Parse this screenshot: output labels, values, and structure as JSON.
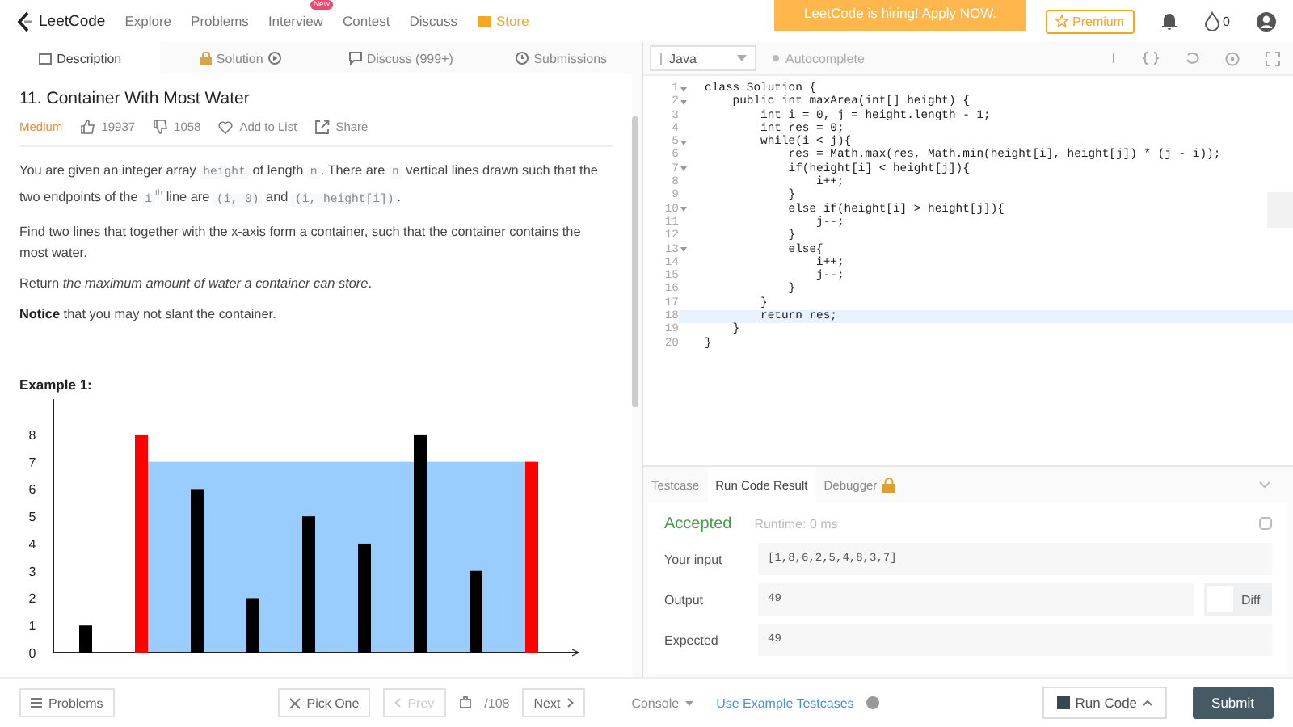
{
  "nav": {
    "logo": "LeetCode",
    "items": [
      {
        "label": "Explore",
        "kind": "link"
      },
      {
        "label": "Problems",
        "kind": "link"
      },
      {
        "label": "Interview",
        "kind": "link",
        "badge": "New"
      },
      {
        "label": "Contest",
        "kind": "link"
      },
      {
        "label": "Discuss",
        "kind": "link"
      },
      {
        "label": "Store",
        "kind": "store"
      }
    ],
    "banner": "LeetCode is hiring! Apply NOW.",
    "premium": "Premium",
    "points": "0"
  },
  "left_tabs": [
    {
      "label": "Description",
      "selected": true
    },
    {
      "label": "Solution",
      "selected": false
    },
    {
      "label": "Discuss (999+)",
      "selected": false
    },
    {
      "label": "Submissions",
      "selected": false
    }
  ],
  "problem": {
    "title": "11. Container With Most Water",
    "difficulty": "Medium",
    "likes": "19937",
    "dislikes": "1058",
    "add_to_list": "Add to List",
    "share": "Share",
    "paragraphs": [
      [
        {
          "kind": "plain",
          "text": "You are given an integer array "
        },
        {
          "kind": "code",
          "text": "height"
        },
        {
          "kind": "plain",
          "text": " of length "
        },
        {
          "kind": "code",
          "text": "n"
        },
        {
          "kind": "plain",
          "text": ". There are "
        },
        {
          "kind": "code",
          "text": "n"
        },
        {
          "kind": "plain",
          "text": " vertical lines drawn such that the two endpoints of the "
        },
        {
          "kind": "code",
          "text": "i"
        },
        {
          "kind": "sup",
          "text": "th"
        },
        {
          "kind": "plain",
          "text": " line are "
        },
        {
          "kind": "code",
          "text": "(i, 0)"
        },
        {
          "kind": "plain",
          "text": " and "
        },
        {
          "kind": "code",
          "text": "(i, height[i])"
        },
        {
          "kind": "plain",
          "text": "."
        }
      ],
      [
        {
          "kind": "plain",
          "text": "Find two lines that together with the x-axis form a container, such that the container contains the most water."
        }
      ],
      [
        {
          "kind": "plain",
          "text": "Return "
        },
        {
          "kind": "italic",
          "text": "the maximum amount of water a container can store"
        },
        {
          "kind": "plain",
          "text": "."
        }
      ],
      [
        {
          "kind": "bold",
          "text": "Notice"
        },
        {
          "kind": "plain",
          "text": " that you may not slant the container."
        }
      ]
    ],
    "example_title": "Example 1:",
    "chart_data": {
      "type": "bar",
      "stacked": true,
      "ylim": [
        0,
        9.3
      ],
      "yticks": [
        0,
        1,
        2,
        3,
        4,
        5,
        6,
        7,
        8
      ],
      "series": [
        {
          "color": "#000000",
          "values": [
            1,
            null,
            6,
            2,
            5,
            4,
            8,
            3,
            null
          ]
        },
        {
          "color": "#ff0000",
          "values": [
            null,
            8,
            null,
            null,
            null,
            null,
            null,
            null,
            7
          ]
        }
      ]
    }
  },
  "editor": {
    "language": "Java",
    "autocomplete": "Autocomplete",
    "lines": [
      {
        "n": "1",
        "text": "class Solution {",
        "fold": true,
        "current": false
      },
      {
        "n": "2",
        "text": "    public int maxArea(int[] height) {",
        "fold": true,
        "current": false
      },
      {
        "n": "3",
        "text": "        int i = 0, j = height.length - 1;",
        "fold": false,
        "current": false
      },
      {
        "n": "4",
        "text": "        int res = 0;",
        "fold": false,
        "current": false
      },
      {
        "n": "5",
        "text": "        while(i < j){",
        "fold": true,
        "current": false
      },
      {
        "n": "6",
        "text": "            res = Math.max(res, Math.min(height[i], height[j]) * (j - i));",
        "fold": false,
        "current": false
      },
      {
        "n": "7",
        "text": "            if(height[i] < height[j]){",
        "fold": true,
        "current": false
      },
      {
        "n": "8",
        "text": "                i++;",
        "fold": false,
        "current": false
      },
      {
        "n": "9",
        "text": "            }",
        "fold": false,
        "current": false
      },
      {
        "n": "10",
        "text": "            else if(height[i] > height[j]){",
        "fold": true,
        "current": false
      },
      {
        "n": "11",
        "text": "                j--;",
        "fold": false,
        "current": false
      },
      {
        "n": "12",
        "text": "            }",
        "fold": false,
        "current": false
      },
      {
        "n": "13",
        "text": "            else{",
        "fold": true,
        "current": false
      },
      {
        "n": "14",
        "text": "                i++;",
        "fold": false,
        "current": false
      },
      {
        "n": "15",
        "text": "                j--;",
        "fold": false,
        "current": false
      },
      {
        "n": "16",
        "text": "            }",
        "fold": false,
        "current": false
      },
      {
        "n": "17",
        "text": "        }",
        "fold": false,
        "current": false
      },
      {
        "n": "18",
        "text": "        return res;",
        "fold": false,
        "current": true
      },
      {
        "n": "19",
        "text": "    }",
        "fold": false,
        "current": false
      },
      {
        "n": "20",
        "text": "}",
        "fold": false,
        "current": false
      }
    ]
  },
  "result_tabs": [
    {
      "label": "Testcase",
      "selected": false,
      "locked": false
    },
    {
      "label": "Run Code Result",
      "selected": true,
      "locked": false
    },
    {
      "label": "Debugger",
      "selected": false,
      "locked": true
    }
  ],
  "result": {
    "status": "Accepted",
    "runtime": "Runtime: 0 ms",
    "rows": [
      {
        "label": "Your input",
        "value": "[1,8,6,2,5,4,8,3,7]",
        "diff": false
      },
      {
        "label": "Output",
        "value": "49",
        "diff": true
      },
      {
        "label": "Expected",
        "value": "49",
        "diff": false
      }
    ],
    "diff_label": "Diff",
    "diff_on": false
  },
  "bottom_bar": {
    "problems": "Problems",
    "pick_one": "Pick One",
    "prev": "Prev",
    "counter": "/108",
    "next": "Next",
    "console": "Console",
    "use_example": "Use Example Testcases",
    "run_code": "Run Code",
    "submit": "Submit"
  }
}
